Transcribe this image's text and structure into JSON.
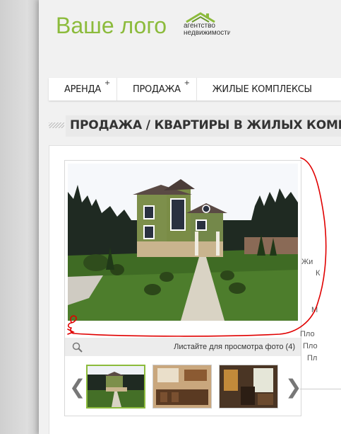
{
  "header": {
    "logo_text": "Ваше лого",
    "agency_line1": "агентство",
    "agency_line2": "недвижимости"
  },
  "menu": {
    "items": [
      {
        "label": "Аренда",
        "has_submenu": true
      },
      {
        "label": "Продажа",
        "has_submenu": true
      },
      {
        "label": "Жилые комплексы",
        "has_submenu": false
      }
    ],
    "submenu_marker": "+"
  },
  "page_title": "ПРОДАЖА / КВАРТИРЫ В ЖИЛЫХ КОМПЛЕКСАХ",
  "gallery": {
    "caption": "Листайте для просмотра фото (4)",
    "prev_arrow": "❮",
    "next_arrow": "❯"
  },
  "side_info": {
    "lines": [
      "Жи",
      "К",
      "М",
      "Пло",
      "Пло",
      "Пл"
    ]
  },
  "colors": {
    "accent": "#8cbb3c",
    "annotation": "#e00000"
  }
}
